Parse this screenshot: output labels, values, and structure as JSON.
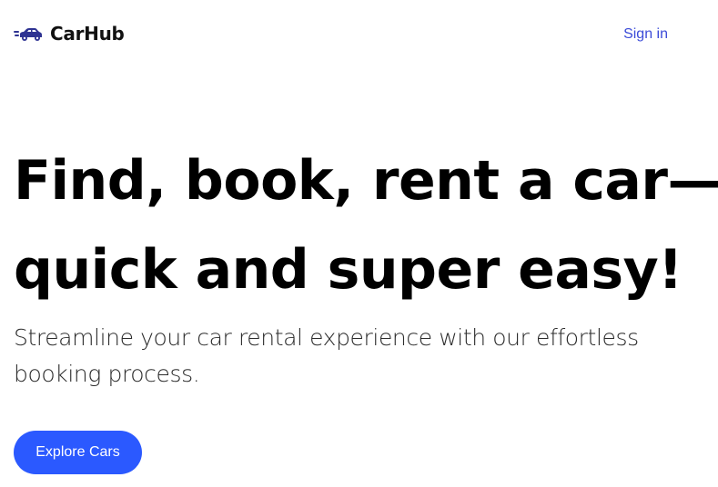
{
  "colors": {
    "accent": "#2b59ff",
    "link": "#3b4bd8",
    "logo_icon": "#2e3392",
    "text": "#000000"
  },
  "navbar": {
    "logo_icon": "car-icon",
    "logo_text": "CarHub",
    "signin_label": "Sign in"
  },
  "hero": {
    "title_line1": "Find, book, rent a car—",
    "title_line2": "quick and super easy!",
    "subtitle_line1": "Streamline your car rental experience with our effortless",
    "subtitle_line2": "booking process.",
    "cta_label": "Explore Cars"
  }
}
